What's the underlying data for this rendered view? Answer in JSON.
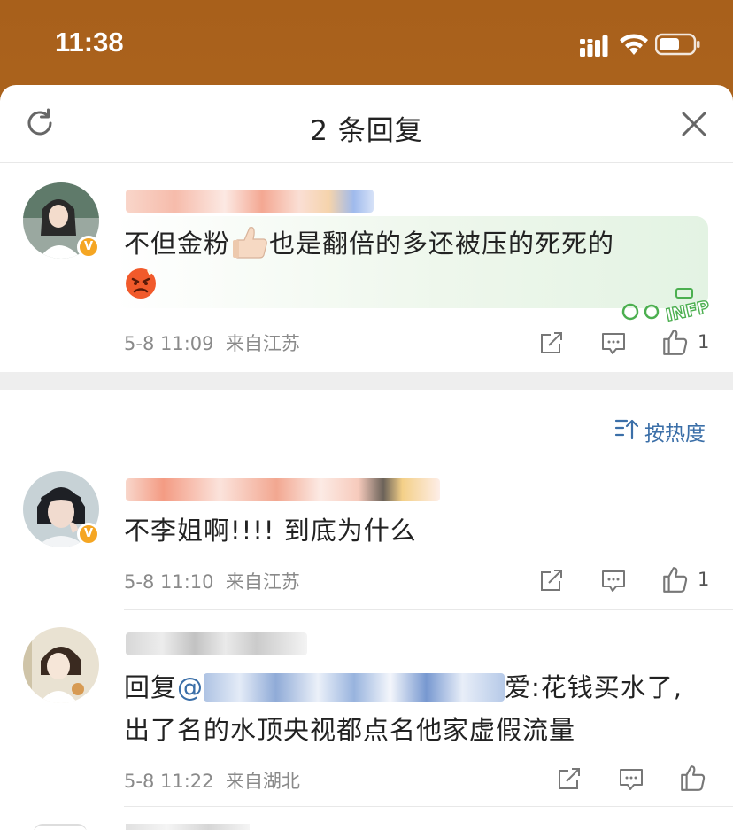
{
  "status_bar": {
    "time": "11:38"
  },
  "sheet": {
    "title": "2 条回复"
  },
  "original_comment": {
    "text_before_emoji": "不但金粉",
    "text_after_emoji": "也是翻倍的多还被压的死死的",
    "timestamp": "5-8 11:09",
    "location": "来自江苏",
    "likes": "1",
    "badge": "V",
    "bubble_tag": "INFP"
  },
  "sort": {
    "label": "按热度"
  },
  "replies": [
    {
      "text": "不李姐啊!!!! 到底为什么",
      "timestamp": "5-8 11:10",
      "location": "来自江苏",
      "likes": "1",
      "badge": "V"
    },
    {
      "reply_prefix": "回复",
      "mention": "@",
      "line1_suffix": "爱:花钱买水了,",
      "line2": "出了名的水顶央视都点名他家虚假流量",
      "timestamp": "5-8 11:22",
      "location": "来自湖北",
      "likes": ""
    }
  ],
  "colors": {
    "accent": "#3b6fa8",
    "badge": "#f5a623",
    "header_gradient": "#a8601b"
  }
}
